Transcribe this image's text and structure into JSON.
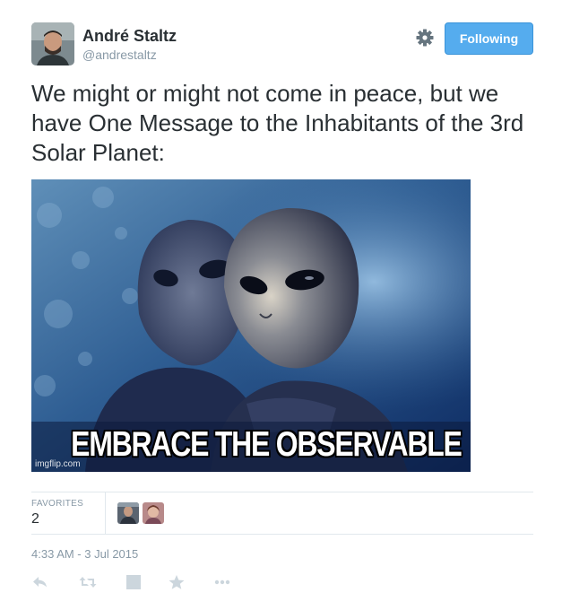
{
  "tweet": {
    "author_name": "André Staltz",
    "author_handle": "@andrestaltz",
    "follow_label": "Following",
    "text": "We might or might not come in peace, but we have One Message to the Inhabitants of the 3rd Solar Planet:",
    "media": {
      "caption": "EMBRACE THE OBSERVABLE",
      "watermark": "imgflip.com"
    },
    "stats": {
      "favorites_label": "FAVORITES",
      "favorites_count": "2"
    },
    "timestamp": "4:33 AM - 3 Jul 2015"
  },
  "icons": {
    "settings": "gear-icon",
    "reply": "reply-icon",
    "retweet": "retweet-icon",
    "square": "square-icon",
    "favorite": "star-icon",
    "more": "more-icon"
  },
  "colors": {
    "follow_button_bg": "#55acee",
    "muted_text": "#8899a6",
    "icon_gray": "#ccd6dd",
    "divider": "#e1e8ed"
  }
}
